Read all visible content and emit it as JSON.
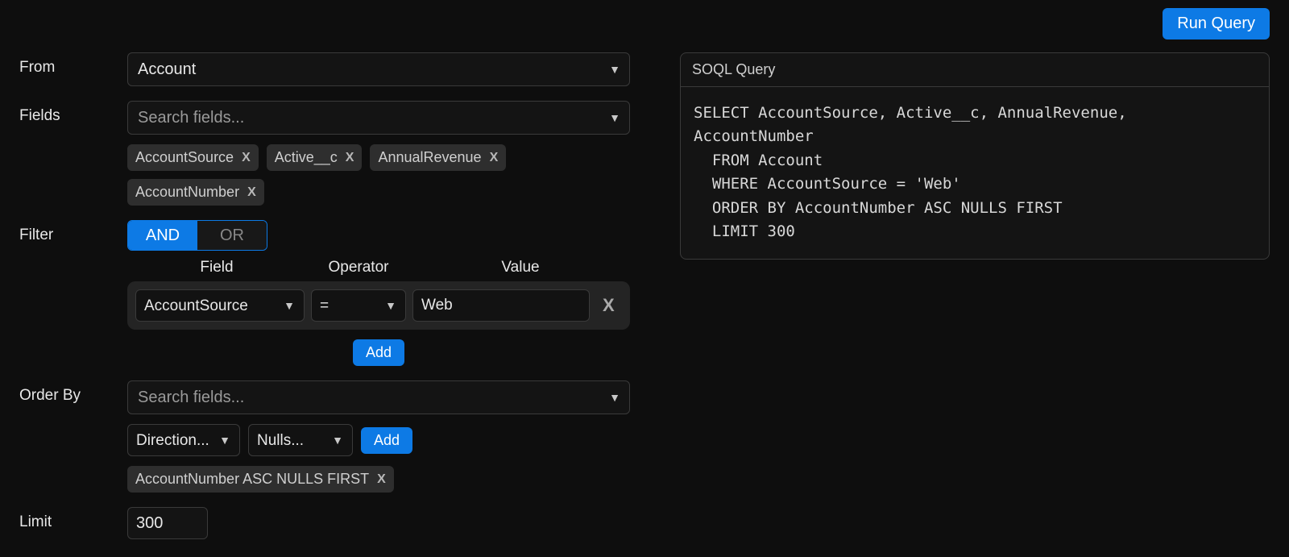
{
  "topbar": {
    "run_query": "Run Query"
  },
  "labels": {
    "from": "From",
    "fields": "Fields",
    "filter": "Filter",
    "order_by": "Order By",
    "limit": "Limit"
  },
  "from": {
    "selected": "Account"
  },
  "fields": {
    "placeholder": "Search fields...",
    "chips": [
      "AccountSource",
      "Active__c",
      "AnnualRevenue",
      "AccountNumber"
    ]
  },
  "filter": {
    "and_label": "AND",
    "or_label": "OR",
    "active": "AND",
    "headers": {
      "field": "Field",
      "operator": "Operator",
      "value": "Value"
    },
    "row": {
      "field": "AccountSource",
      "operator": "=",
      "value": "Web"
    },
    "add_label": "Add"
  },
  "orderby": {
    "placeholder": "Search fields...",
    "direction_placeholder": "Direction...",
    "nulls_placeholder": "Nulls...",
    "add_label": "Add",
    "chips": [
      "AccountNumber ASC NULLS FIRST"
    ]
  },
  "limit": {
    "value": "300"
  },
  "query_panel": {
    "title": "SOQL Query",
    "lines": [
      "SELECT AccountSource, Active__c, AnnualRevenue,",
      "AccountNumber",
      "  FROM Account",
      "  WHERE AccountSource = 'Web'",
      "  ORDER BY AccountNumber ASC NULLS FIRST",
      "  LIMIT 300"
    ]
  }
}
